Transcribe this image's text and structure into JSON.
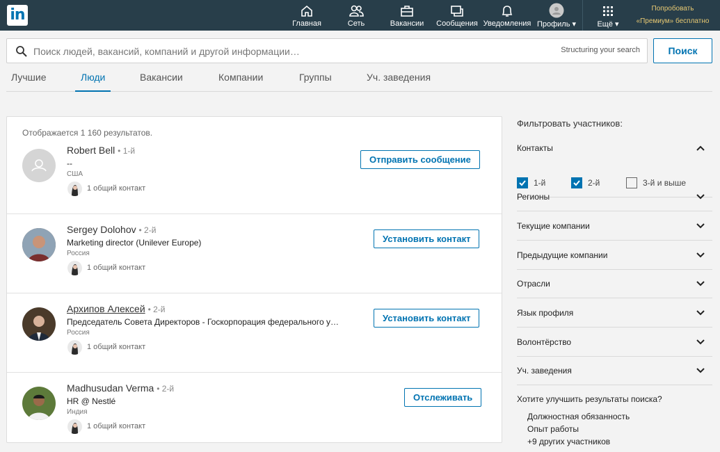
{
  "nav": {
    "items": [
      {
        "label": "Главная",
        "icon": "home-icon"
      },
      {
        "label": "Сеть",
        "icon": "network-icon"
      },
      {
        "label": "Вакансии",
        "icon": "briefcase-icon"
      },
      {
        "label": "Сообщения",
        "icon": "messages-icon"
      },
      {
        "label": "Уведомления",
        "icon": "bell-icon"
      },
      {
        "label": "Профиль ▾",
        "icon": "avatar-icon"
      },
      {
        "label": "Ещё ▾",
        "icon": "grid-icon"
      }
    ],
    "premium_line1": "Попробовать",
    "premium_line2": "«Премиум» бесплатно"
  },
  "search": {
    "placeholder": "Поиск людей, вакансий, компаний и другой информации…",
    "structuring": "Structuring your search",
    "button": "Поиск"
  },
  "tabs": [
    "Лучшие",
    "Люди",
    "Вакансии",
    "Компании",
    "Группы",
    "Уч. заведения"
  ],
  "results": {
    "count_text": "Отображается 1 160 результатов.",
    "people": [
      {
        "name": "Robert Bell",
        "degree": "• 1-й",
        "headline": "--",
        "location": "США",
        "shared": "1 общий контакт",
        "action": "Отправить сообщение"
      },
      {
        "name": "Sergey Dolohov",
        "degree": "• 2-й",
        "headline": "Marketing director (Unilever Europe)",
        "location": "Россия",
        "shared": "1 общий контакт",
        "action": "Установить контакт"
      },
      {
        "name": "Архипов Алексей",
        "degree": "• 2-й",
        "headline": "Председатель Совета Директоров - Госкорпорация федерального у…",
        "location": "Россия",
        "shared": "1 общий контакт",
        "action": "Установить контакт"
      },
      {
        "name": "Madhusudan Verma",
        "degree": "• 2-й",
        "headline": "HR @ Nestlé",
        "location": "Индия",
        "shared": "1 общий контакт",
        "action": "Отслеживать"
      }
    ]
  },
  "filters": {
    "title": "Фильтровать участников:",
    "contacts": {
      "label": "Контакты",
      "options": [
        {
          "label": "1-й",
          "checked": true
        },
        {
          "label": "2-й",
          "checked": true
        },
        {
          "label": "3-й и выше",
          "checked": false
        }
      ]
    },
    "sections": [
      "Регионы",
      "Текущие компании",
      "Предыдущие компании",
      "Отрасли",
      "Язык профиля",
      "Волонтёрство",
      "Уч. заведения"
    ],
    "improve_title": "Хотите улучшить результаты поиска?",
    "improve_items": [
      "Должностная обязанность",
      "Опыт работы",
      "+9 других участников"
    ]
  },
  "colors": {
    "topbar": "#283e4a",
    "accent": "#0073b1",
    "premium": "#e7c872"
  }
}
